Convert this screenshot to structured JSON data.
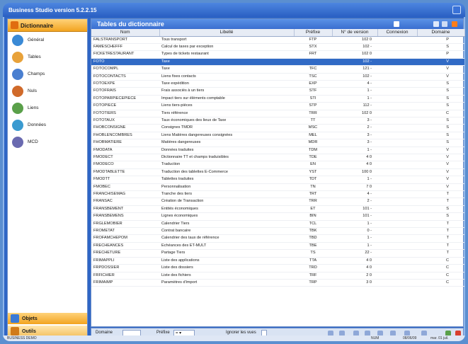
{
  "window": {
    "title": "Business Studio version 5.2.2.15"
  },
  "sidebar": {
    "header": "Dictionnaire",
    "items": [
      {
        "label": "Général",
        "icon": "globe-icon",
        "color": "#3a8ad6"
      },
      {
        "label": "Tables",
        "icon": "table-icon",
        "color": "#e8a23a"
      },
      {
        "label": "Champs",
        "icon": "document-icon",
        "color": "#4a7fd0"
      },
      {
        "label": "Nuls",
        "icon": "cube-icon",
        "color": "#d06a2a"
      },
      {
        "label": "Liens",
        "icon": "link-icon",
        "color": "#5aa04a"
      },
      {
        "label": "Données",
        "icon": "data-icon",
        "color": "#3a9ad0"
      },
      {
        "label": "MCD",
        "icon": "diagram-icon",
        "color": "#6a6ab0"
      }
    ],
    "bottom": [
      {
        "label": "Objets",
        "icon": "objects-icon"
      },
      {
        "label": "Outils",
        "icon": "tools-icon"
      }
    ]
  },
  "main": {
    "title": "Tables du dictionnaire",
    "columns": [
      "Nom",
      "Libellé",
      "Préfixe",
      "N° de version",
      "Connexion",
      "Domaine"
    ],
    "selected_index": 3,
    "rows": [
      [
        "FALSTRANSPORT",
        "Tous transport",
        "FTP",
        "102 0",
        "",
        "P"
      ],
      [
        "FAMESCHEFFF",
        "Calcul de taxes par exception",
        "STX",
        "102 -",
        "",
        "S"
      ],
      [
        "FICKETRESTAURANT",
        "Types de tickets restaurant",
        "FRT",
        "102 0",
        "",
        "P"
      ],
      [
        "FOTO",
        "Taxe",
        "",
        "102 -",
        "",
        "V"
      ],
      [
        "FOTOCOMPL",
        "Taxe",
        "TFC",
        "121 -",
        "",
        "V"
      ],
      [
        "FOTOCONTACTS",
        "Liens fixes contacts",
        "TSC",
        "102 -",
        "",
        "V"
      ],
      [
        "FOTOEXPE",
        "Taxe expédition",
        "EXP",
        "4 -",
        "",
        "S"
      ],
      [
        "FOTOFRAIS",
        "Frais associés à un tiers",
        "STF",
        "1 -",
        "",
        "S"
      ],
      [
        "FOTOPARPIECEPIECE",
        "Impact tiers sur éléments comptable",
        "STI",
        "1 -",
        "",
        "S"
      ],
      [
        "FOTOPIECE",
        "Liens tiers-pièces",
        "STP",
        "112 -",
        "",
        "S"
      ],
      [
        "FOTOTIERS",
        "Tiers référence",
        "TRR",
        "102 0",
        "",
        "C"
      ],
      [
        "FOTOTAUX",
        "Taux économiques des lieux de Taxe",
        "TT",
        "3 -",
        "",
        "S"
      ],
      [
        "FHOBCONSIGNE",
        "Consignes TMDR",
        "MSC",
        "2 -",
        "",
        "S"
      ],
      [
        "FHOBLENCOMBRES",
        "Liens Matières dangereuses consignées",
        "MEL",
        "3 -",
        "",
        "S"
      ],
      [
        "FHOBMATIERE",
        "Matières dangereuses",
        "MDR",
        "3 -",
        "",
        "S"
      ],
      [
        "FMODATA",
        "Données traduites",
        "TDM",
        "1 -",
        "",
        "V"
      ],
      [
        "FMODECT",
        "Dictionnaire TT et champs traduisibles",
        "TDE",
        "4 0",
        "",
        "V"
      ],
      [
        "FMODECO",
        "Traduction",
        "EN",
        "4 0",
        "",
        "V"
      ],
      [
        "FMODTABLETTE",
        "Traduction des tablettes E-Commerce",
        "YST",
        "100 0",
        "",
        "V"
      ],
      [
        "FMODTT",
        "Tablettes traduites",
        "TDT",
        "1 -",
        "",
        "V"
      ],
      [
        "FMOBEC",
        "Personnalisation",
        "TN",
        "7 0",
        "",
        "V"
      ],
      [
        "FRANCHISEMAG",
        "Tranche des tiers",
        "TRT",
        "4 -",
        "",
        "T"
      ],
      [
        "FRANSAC",
        "Création de Transaction",
        "TRR",
        "2 -",
        "",
        "T"
      ],
      [
        "FRANSBEMENT",
        "Entités économiques",
        "ET",
        "101 -",
        "",
        "S"
      ],
      [
        "FRANSBEMENS",
        "Lignes économiques",
        "BIN",
        "101 -",
        "",
        "S"
      ],
      [
        "FRGLEMOBIER",
        "Calendrier Tiers",
        "TCL",
        "1 -",
        "",
        "T"
      ],
      [
        "FROMETAT",
        "Contrat bancaire",
        "TBK",
        "0 -",
        "",
        "T"
      ],
      [
        "FROFAMCHEPOM",
        "Calendrier des taux de référence",
        "TBD",
        "1 -",
        "",
        "T"
      ],
      [
        "FRECHEANCES",
        "Echéances des ET-MULT",
        "TBE",
        "1 -",
        "",
        "T"
      ],
      [
        "FRECHETURE",
        "Partage Tiers",
        "TS",
        "22 -",
        "",
        "T"
      ],
      [
        "FRIMAPPLI",
        "Liste des applications",
        "TTA",
        "4 0",
        "",
        "C"
      ],
      [
        "FRPDOSSIER",
        "Liste des dossiers",
        "TRD",
        "4 0",
        "",
        "C"
      ],
      [
        "FRFICHIER",
        "Liste des fichiers",
        "TRF",
        "2 0",
        "",
        "C"
      ],
      [
        "FRIMAIMP",
        "Paramètres d'import",
        "TRP",
        "3 0",
        "",
        "C"
      ]
    ]
  },
  "statusline": {
    "domain_label": "Domaine",
    "prefix_label": "Préfixe",
    "prefix_value": "= ▾",
    "ignore_label": "Ignorer les vues"
  },
  "bottombar": {
    "left": "BUSINESS DEMO",
    "user": "NUM",
    "date": "08/06/09",
    "day": "mar. 01 juil."
  }
}
